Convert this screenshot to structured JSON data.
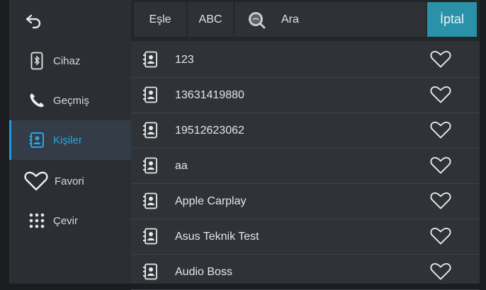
{
  "sidebar": {
    "back_icon": "back-arrow-icon",
    "items": [
      {
        "label": "Cihaz",
        "icon": "bluetooth-phone-icon"
      },
      {
        "label": "Geçmiş",
        "icon": "phone-handset-icon"
      },
      {
        "label": "Kişiler",
        "icon": "contact-card-icon",
        "active": true
      },
      {
        "label": "Favori",
        "icon": "heart-icon"
      },
      {
        "label": "Çevir",
        "icon": "dialpad-icon"
      }
    ]
  },
  "toolbar": {
    "sync_label": "Eşle",
    "abc_label": "ABC",
    "search_placeholder": "Ara",
    "cancel_label": "İptal"
  },
  "contacts": [
    {
      "name": "123"
    },
    {
      "name": "13631419880"
    },
    {
      "name": "19512623062"
    },
    {
      "name": "aa"
    },
    {
      "name": "Apple Carplay"
    },
    {
      "name": "Asus Teknik Test"
    },
    {
      "name": "Audio Boss"
    }
  ],
  "colors": {
    "accent": "#2aa5e0",
    "cancel_bg": "#2a92a8",
    "sidebar_bg": "#2b2e33",
    "list_bg": "#2f3237"
  }
}
